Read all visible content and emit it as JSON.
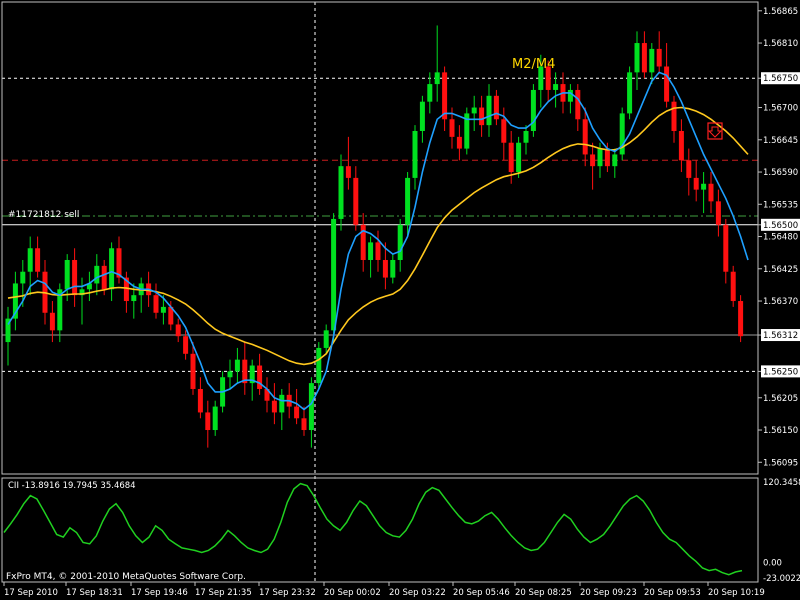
{
  "window": {
    "copyright": "FxPro MT4, © 2001-2010 MetaQuotes Software Corp."
  },
  "annotations": {
    "trade_label": "#11721812 sell",
    "pattern_label": "M2/M4"
  },
  "colors": {
    "background": "#000000",
    "grid": "#c0c0c0",
    "bull": "#00e020",
    "bear": "#ff1010",
    "ma_fast": "#1ea0ff",
    "ma_slow": "#ffc81e",
    "indicator": "#20d020",
    "level_red": "#c81e1e",
    "level_green": "#3fa03f",
    "text": "#ffffff"
  },
  "chart_data": [
    {
      "type": "candlestick",
      "ylim": [
        1.56075,
        1.5688
      ],
      "y_ticks": [
        "1.56865",
        "1.56810",
        "1.56750",
        "1.56700",
        "1.56645",
        "1.56590",
        "1.56535",
        "1.56500",
        "1.56480",
        "1.56425",
        "1.56370",
        "1.56312",
        "1.56250",
        "1.56205",
        "1.56150",
        "1.56095"
      ],
      "x_ticks": [
        "17 Sep 2010",
        "17 Sep 18:31",
        "17 Sep 19:46",
        "17 Sep 21:35",
        "17 Sep 23:32",
        "20 Sep 00:02",
        "20 Sep 03:22",
        "20 Sep 05:46",
        "20 Sep 08:25",
        "20 Sep 09:23",
        "20 Sep 09:53",
        "20 Sep 10:19"
      ],
      "current_price": "1.56312",
      "levels": [
        {
          "price": "1.56750",
          "style": "white-dashed",
          "label": "1.56750"
        },
        {
          "price": "1.56610",
          "style": "red-dashed"
        },
        {
          "price": "1.56515",
          "style": "green-dashdot"
        },
        {
          "price": "1.56500",
          "style": "white-solid",
          "label": "1.56500"
        },
        {
          "price": "1.56312",
          "style": "gray-solid",
          "label": "1.56312"
        },
        {
          "price": "1.56250",
          "style": "white-dashed",
          "label": "1.56250"
        }
      ],
      "candles": [
        [
          1.563,
          1.5636,
          1.5626,
          1.5634
        ],
        [
          1.5634,
          1.5642,
          1.5632,
          1.564
        ],
        [
          1.564,
          1.5644,
          1.5636,
          1.5642
        ],
        [
          1.5642,
          1.5648,
          1.5638,
          1.5646
        ],
        [
          1.5646,
          1.5648,
          1.5641,
          1.5642
        ],
        [
          1.5642,
          1.5644,
          1.5633,
          1.5635
        ],
        [
          1.5635,
          1.5637,
          1.563,
          1.5632
        ],
        [
          1.5632,
          1.564,
          1.563,
          1.5639
        ],
        [
          1.5639,
          1.5645,
          1.5637,
          1.5644
        ],
        [
          1.5644,
          1.5646,
          1.5636,
          1.5638
        ],
        [
          1.5638,
          1.5641,
          1.5633,
          1.5639
        ],
        [
          1.5639,
          1.5642,
          1.5637,
          1.564
        ],
        [
          1.564,
          1.5645,
          1.5638,
          1.5643
        ],
        [
          1.5643,
          1.5644,
          1.5638,
          1.5639
        ],
        [
          1.5639,
          1.5647,
          1.5637,
          1.5646
        ],
        [
          1.5646,
          1.5648,
          1.564,
          1.5641
        ],
        [
          1.5641,
          1.5642,
          1.5635,
          1.5637
        ],
        [
          1.5637,
          1.564,
          1.5634,
          1.5638
        ],
        [
          1.5638,
          1.5641,
          1.5635,
          1.564
        ],
        [
          1.564,
          1.5642,
          1.5636,
          1.5638
        ],
        [
          1.5638,
          1.564,
          1.5634,
          1.5635
        ],
        [
          1.5635,
          1.5638,
          1.5633,
          1.5636
        ],
        [
          1.5636,
          1.5637,
          1.5632,
          1.5633
        ],
        [
          1.5633,
          1.5634,
          1.563,
          1.5631
        ],
        [
          1.5631,
          1.5632,
          1.5627,
          1.5628
        ],
        [
          1.5628,
          1.563,
          1.5621,
          1.5622
        ],
        [
          1.5622,
          1.5624,
          1.5617,
          1.5618
        ],
        [
          1.5618,
          1.562,
          1.5612,
          1.5615
        ],
        [
          1.5615,
          1.562,
          1.5614,
          1.5619
        ],
        [
          1.5619,
          1.5625,
          1.5618,
          1.5624
        ],
        [
          1.5624,
          1.5627,
          1.5622,
          1.5625
        ],
        [
          1.5625,
          1.5629,
          1.5623,
          1.5627
        ],
        [
          1.5627,
          1.563,
          1.5621,
          1.5623
        ],
        [
          1.5623,
          1.5627,
          1.562,
          1.5626
        ],
        [
          1.5626,
          1.5628,
          1.5621,
          1.5622
        ],
        [
          1.5622,
          1.5624,
          1.5618,
          1.562
        ],
        [
          1.562,
          1.5623,
          1.5616,
          1.5618
        ],
        [
          1.5618,
          1.5622,
          1.5615,
          1.5621
        ],
        [
          1.5621,
          1.5623,
          1.5617,
          1.5619
        ],
        [
          1.5619,
          1.5622,
          1.5616,
          1.5617
        ],
        [
          1.5617,
          1.5619,
          1.5614,
          1.5615
        ],
        [
          1.5615,
          1.5624,
          1.5612,
          1.5623
        ],
        [
          1.5623,
          1.563,
          1.5622,
          1.5629
        ],
        [
          1.5629,
          1.5633,
          1.5628,
          1.5632
        ],
        [
          1.5632,
          1.5652,
          1.563,
          1.5651
        ],
        [
          1.5651,
          1.5662,
          1.5649,
          1.566
        ],
        [
          1.566,
          1.5665,
          1.5656,
          1.5658
        ],
        [
          1.5658,
          1.566,
          1.5649,
          1.565
        ],
        [
          1.565,
          1.5652,
          1.5642,
          1.5644
        ],
        [
          1.5644,
          1.5648,
          1.5641,
          1.5647
        ],
        [
          1.5647,
          1.5649,
          1.5642,
          1.5644
        ],
        [
          1.5644,
          1.5647,
          1.5639,
          1.5641
        ],
        [
          1.5641,
          1.5645,
          1.564,
          1.5644
        ],
        [
          1.5644,
          1.5651,
          1.5642,
          1.565
        ],
        [
          1.565,
          1.5659,
          1.5648,
          1.5658
        ],
        [
          1.5658,
          1.5667,
          1.5656,
          1.5666
        ],
        [
          1.5666,
          1.5672,
          1.5664,
          1.5671
        ],
        [
          1.5671,
          1.5676,
          1.5669,
          1.5674
        ],
        [
          1.5674,
          1.5684,
          1.5671,
          1.5676
        ],
        [
          1.5676,
          1.5677,
          1.5666,
          1.5668
        ],
        [
          1.5668,
          1.567,
          1.5663,
          1.5665
        ],
        [
          1.5665,
          1.5667,
          1.5661,
          1.5663
        ],
        [
          1.5663,
          1.567,
          1.5662,
          1.5669
        ],
        [
          1.5669,
          1.5672,
          1.5666,
          1.567
        ],
        [
          1.567,
          1.5672,
          1.5665,
          1.5667
        ],
        [
          1.5667,
          1.5674,
          1.5665,
          1.5672
        ],
        [
          1.5672,
          1.5673,
          1.5667,
          1.5668
        ],
        [
          1.5668,
          1.567,
          1.5661,
          1.5664
        ],
        [
          1.5664,
          1.5666,
          1.5657,
          1.5659
        ],
        [
          1.5659,
          1.5665,
          1.5658,
          1.5664
        ],
        [
          1.5664,
          1.5667,
          1.5662,
          1.5666
        ],
        [
          1.5666,
          1.5674,
          1.5665,
          1.5673
        ],
        [
          1.5673,
          1.5679,
          1.567,
          1.5677
        ],
        [
          1.5677,
          1.5678,
          1.5671,
          1.5673
        ],
        [
          1.5673,
          1.5676,
          1.567,
          1.5674
        ],
        [
          1.5674,
          1.5676,
          1.5669,
          1.5671
        ],
        [
          1.5671,
          1.5674,
          1.5669,
          1.5673
        ],
        [
          1.5673,
          1.5674,
          1.5666,
          1.5668
        ],
        [
          1.5668,
          1.567,
          1.566,
          1.5662
        ],
        [
          1.5662,
          1.5664,
          1.5656,
          1.566
        ],
        [
          1.566,
          1.5664,
          1.5658,
          1.5663
        ],
        [
          1.5663,
          1.5664,
          1.5659,
          1.566
        ],
        [
          1.566,
          1.5663,
          1.5658,
          1.5662
        ],
        [
          1.5662,
          1.567,
          1.5661,
          1.5669
        ],
        [
          1.5669,
          1.5677,
          1.5668,
          1.5676
        ],
        [
          1.5676,
          1.5683,
          1.5673,
          1.5681
        ],
        [
          1.5681,
          1.5683,
          1.5675,
          1.5676
        ],
        [
          1.5676,
          1.5681,
          1.5674,
          1.568
        ],
        [
          1.568,
          1.5683,
          1.5676,
          1.5677
        ],
        [
          1.5677,
          1.5681,
          1.567,
          1.5671
        ],
        [
          1.5671,
          1.5672,
          1.5664,
          1.5666
        ],
        [
          1.5666,
          1.5668,
          1.5659,
          1.5661
        ],
        [
          1.5661,
          1.5663,
          1.5655,
          1.5658
        ],
        [
          1.5658,
          1.5661,
          1.5654,
          1.5656
        ],
        [
          1.5656,
          1.5659,
          1.5652,
          1.5657
        ],
        [
          1.5657,
          1.5659,
          1.5652,
          1.5654
        ],
        [
          1.5654,
          1.5656,
          1.5648,
          1.565
        ],
        [
          1.565,
          1.5651,
          1.564,
          1.5642
        ],
        [
          1.5642,
          1.5643,
          1.5636,
          1.5637
        ],
        [
          1.5637,
          1.5638,
          1.563,
          1.5631
        ]
      ],
      "ma_fast": [
        1.5633,
        1.5635,
        1.5637,
        1.56395,
        1.56405,
        1.564,
        1.56385,
        1.5638,
        1.5639,
        1.56395,
        1.56395,
        1.564,
        1.5641,
        1.56415,
        1.5642,
        1.56415,
        1.56405,
        1.56395,
        1.5639,
        1.5639,
        1.56385,
        1.56375,
        1.5636,
        1.56345,
        1.56325,
        1.56295,
        1.56265,
        1.5623,
        1.56215,
        1.56215,
        1.5622,
        1.5623,
        1.56235,
        1.56235,
        1.5623,
        1.5622,
        1.56205,
        1.562,
        1.562,
        1.56195,
        1.56185,
        1.56195,
        1.5622,
        1.5625,
        1.5631,
        1.5639,
        1.5645,
        1.5648,
        1.5649,
        1.56485,
        1.56475,
        1.5646,
        1.5645,
        1.56455,
        1.5648,
        1.5653,
        1.5659,
        1.5664,
        1.5668,
        1.5669,
        1.5669,
        1.56685,
        1.5668,
        1.5668,
        1.5668,
        1.56685,
        1.5669,
        1.56685,
        1.5667,
        1.56665,
        1.56665,
        1.56675,
        1.56695,
        1.5671,
        1.5672,
        1.56725,
        1.56725,
        1.56715,
        1.56695,
        1.56665,
        1.56645,
        1.5663,
        1.56625,
        1.56635,
        1.56655,
        1.56685,
        1.56715,
        1.56745,
        1.5676,
        1.56755,
        1.56735,
        1.5671,
        1.5668,
        1.5665,
        1.5662,
        1.56595,
        1.5657,
        1.56545,
        1.56515,
        1.5648,
        1.5644
      ],
      "ma_slow": [
        1.56375,
        1.56377,
        1.56379,
        1.56383,
        1.56385,
        1.56384,
        1.56381,
        1.5638,
        1.56381,
        1.56382,
        1.56382,
        1.56384,
        1.56387,
        1.56389,
        1.56392,
        1.56393,
        1.56392,
        1.5639,
        1.56389,
        1.56388,
        1.56386,
        1.56383,
        1.56378,
        1.56372,
        1.56365,
        1.56355,
        1.56344,
        1.56332,
        1.56322,
        1.56315,
        1.5631,
        1.56305,
        1.563,
        1.56296,
        1.56291,
        1.56286,
        1.5628,
        1.56274,
        1.56268,
        1.56264,
        1.56262,
        1.56264,
        1.5627,
        1.5628,
        1.563,
        1.5632,
        1.56338,
        1.5635,
        1.5636,
        1.56368,
        1.56374,
        1.56378,
        1.56382,
        1.5639,
        1.56405,
        1.56425,
        1.56448,
        1.56472,
        1.56495,
        1.56512,
        1.56525,
        1.56535,
        1.56545,
        1.56555,
        1.56563,
        1.5657,
        1.56577,
        1.56582,
        1.56585,
        1.56588,
        1.56592,
        1.56598,
        1.56606,
        1.56615,
        1.56623,
        1.5663,
        1.56635,
        1.56638,
        1.56637,
        1.56634,
        1.5663,
        1.56628,
        1.56628,
        1.56632,
        1.5664,
        1.5665,
        1.56662,
        1.56675,
        1.56686,
        1.56694,
        1.56699,
        1.567,
        1.56698,
        1.56694,
        1.56688,
        1.5668,
        1.5667,
        1.5666,
        1.56648,
        1.56634,
        1.5662
      ]
    },
    {
      "type": "line",
      "name": "CII -13.8916 19.7945 35.4684",
      "ylim": [
        -23.0022,
        120.3458
      ],
      "y_ticks": [
        "120.3458",
        "0.00",
        "-23.0022"
      ],
      "values": [
        45,
        58,
        72,
        88,
        100,
        95,
        78,
        60,
        42,
        38,
        52,
        45,
        30,
        28,
        40,
        62,
        80,
        88,
        75,
        55,
        40,
        30,
        38,
        55,
        48,
        35,
        28,
        22,
        20,
        18,
        15,
        18,
        25,
        35,
        48,
        40,
        30,
        22,
        18,
        15,
        20,
        35,
        60,
        90,
        110,
        118,
        115,
        100,
        82,
        65,
        55,
        48,
        60,
        78,
        92,
        85,
        70,
        55,
        45,
        40,
        38,
        48,
        65,
        88,
        105,
        112,
        108,
        95,
        82,
        70,
        60,
        58,
        62,
        70,
        75,
        65,
        52,
        40,
        30,
        22,
        18,
        20,
        30,
        45,
        60,
        72,
        65,
        50,
        38,
        30,
        35,
        42,
        55,
        70,
        85,
        95,
        100,
        92,
        78,
        60,
        45,
        35,
        30,
        20,
        10,
        2,
        -8,
        -12,
        -10,
        -15,
        -18,
        -14,
        -12
      ]
    }
  ]
}
